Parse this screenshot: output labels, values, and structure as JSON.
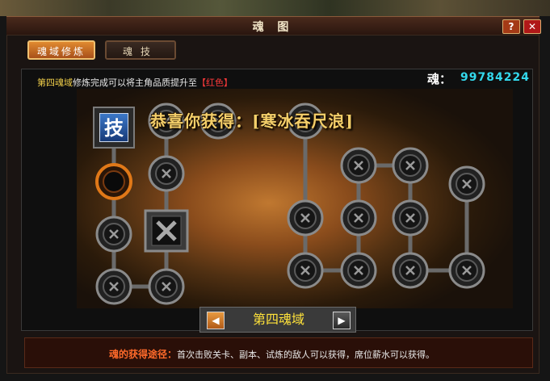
{
  "window": {
    "title": "魂 图",
    "help_label": "?",
    "close_label": "✕"
  },
  "tabs": [
    {
      "label": "魂域修炼",
      "active": true
    },
    {
      "label": "魂技",
      "active": false
    }
  ],
  "info": {
    "prefix": "第四魂域",
    "text": "修炼完成可以将主角品质提升至",
    "quality": "【红色】",
    "colors": {
      "prefix": "#f2d04a",
      "text": "#e8e8e8",
      "quality": "#ff3a3a"
    }
  },
  "soul": {
    "label": "魂：",
    "value": "99784224"
  },
  "congrats": {
    "text": "恭喜你获得：[寒冰吞尺浪]"
  },
  "skill_icon": {
    "glyph": "技",
    "icon": "skill-scroll-icon"
  },
  "realm_nav": {
    "current": "第四魂域",
    "prev_icon": "arrow-left-icon",
    "next_icon": "arrow-right-icon",
    "prev_glyph": "◀",
    "next_glyph": "▶"
  },
  "acquire": {
    "label": "魂的获得途径：",
    "text": "首次击败关卡、副本、试炼的敌人可以获得，席位薪水可以获得。",
    "colors": {
      "label": "#ff6a2a",
      "text": "#e8e8e8"
    }
  },
  "soul_nodes": {
    "node_icon": "locked-node-icon",
    "active_icon": "active-node-icon",
    "special_icon": "special-node-icon",
    "colors": {
      "link": "#6a6a6a",
      "node_ring": "#8a8a8a",
      "active_ring": "#e07818"
    }
  }
}
